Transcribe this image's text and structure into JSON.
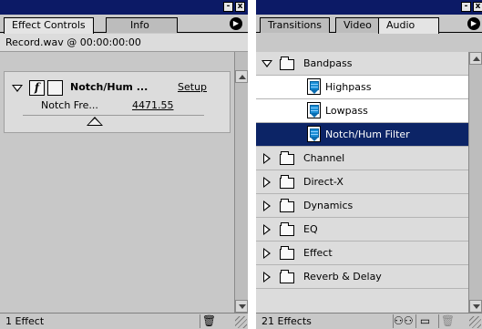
{
  "left_panel": {
    "tabs": [
      {
        "label": "Effect Controls",
        "active": true
      },
      {
        "label": "Info",
        "active": false
      }
    ],
    "clip_header": "Record.wav @ 00:00:00:00",
    "effect": {
      "fx_glyph": "f",
      "name": "Notch/Hum ...",
      "setup_label": "Setup",
      "param_label": "Notch Fre...",
      "param_value": "4471.55"
    },
    "status_text": "1 Effect",
    "icons": {
      "delete": "trash-icon"
    }
  },
  "right_panel": {
    "tabs": [
      {
        "label": "Transitions",
        "active": false
      },
      {
        "label": "Video",
        "active": false
      },
      {
        "label": "Audio",
        "active": true
      }
    ],
    "tree": [
      {
        "label": "Bandpass",
        "kind": "folder",
        "expanded": true
      },
      {
        "label": "Highpass",
        "kind": "effect"
      },
      {
        "label": "Lowpass",
        "kind": "effect"
      },
      {
        "label": "Notch/Hum Filter",
        "kind": "effect",
        "selected": true
      },
      {
        "label": "Channel",
        "kind": "folder"
      },
      {
        "label": "Direct-X",
        "kind": "folder"
      },
      {
        "label": "Dynamics",
        "kind": "folder"
      },
      {
        "label": "EQ",
        "kind": "folder"
      },
      {
        "label": "Effect",
        "kind": "folder"
      },
      {
        "label": "Reverb & Delay",
        "kind": "folder"
      }
    ],
    "status_text": "21 Effects",
    "icons": {
      "find": "binoculars-icon",
      "new_folder": "folder-icon",
      "delete": "trash-icon"
    }
  },
  "window_buttons": {
    "minimize": "-",
    "close": "x",
    "menu": "▶"
  },
  "colors": {
    "titlebar": "#0c1a66",
    "selection": "#0c2466",
    "panel": "#c8c8c8"
  }
}
